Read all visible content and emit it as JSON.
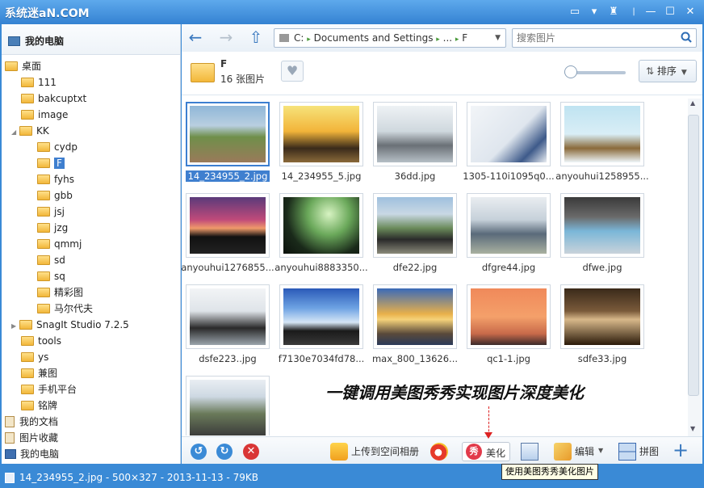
{
  "app": {
    "title": "系统迷aN.COM"
  },
  "sidebar": {
    "header": "我的电脑",
    "tree": [
      "桌面",
      "111",
      "bakcuptxt",
      "image",
      "KK",
      "cydp",
      "F",
      "fyhs",
      "gbb",
      "jsj",
      "jzg",
      "qmmj",
      "sd",
      "sq",
      "精彩图",
      "马尔代夫",
      "SnagIt Studio 7.2.5",
      "tools",
      "ys",
      "兼图",
      "手机平台",
      "铭牌"
    ],
    "bottom": [
      "我的文档",
      "图片收藏",
      "我的电脑"
    ]
  },
  "nav": {
    "path": [
      "C:",
      "Documents and Settings",
      "...",
      "F"
    ],
    "search_placeholder": "搜索图片"
  },
  "folder": {
    "name": "F",
    "count": "16 张图片"
  },
  "sort": {
    "label": "排序"
  },
  "photos": [
    "14_234955_2.jpg",
    "14_234955_5.jpg",
    "36dd.jpg",
    "1305-110i1095q0...",
    "anyouhui1258955...",
    "anyouhui1276855...",
    "anyouhui8883350...",
    "dfe22.jpg",
    "dfgre44.jpg",
    "dfwe.jpg",
    "dsfe223..jpg",
    "f7130e7034fd78...",
    "max_800_13626...",
    "qc1-1.jpg",
    "sdfe33.jpg",
    ""
  ],
  "bottombar": {
    "upload": "上传到空间相册",
    "meitu": "美化",
    "edit": "编辑",
    "mosaic": "拼图"
  },
  "tooltip": "使用美图秀秀美化图片",
  "annotation": "一键调用美图秀秀实现图片深度美化",
  "status": "14_234955_2.jpg - 500×327 - 2013-11-13 - 79KB",
  "colors": {
    "accent": "#3a8ad6",
    "selection": "#3f7fcf",
    "danger": "#d93636"
  }
}
